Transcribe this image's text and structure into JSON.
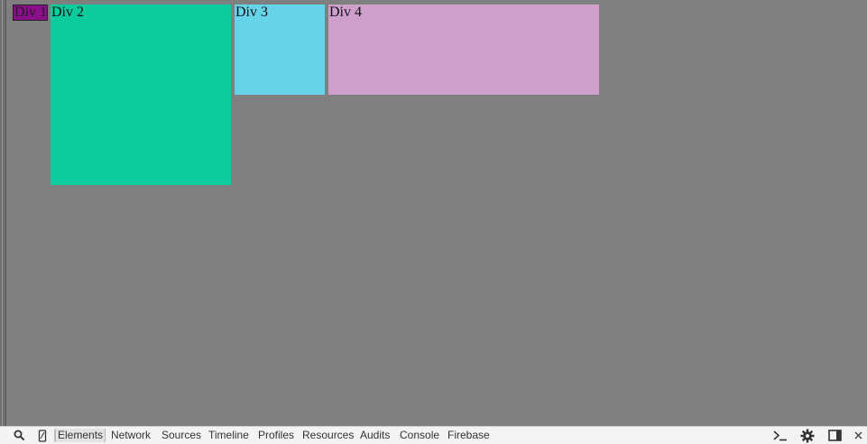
{
  "page": {
    "divs": [
      {
        "id": "div1",
        "label": "Div 1",
        "color": "#8b0f8b"
      },
      {
        "id": "div2",
        "label": "Div 2",
        "color": "#0acc9d"
      },
      {
        "id": "div3",
        "label": "Div 3",
        "color": "#66d4e8"
      },
      {
        "id": "div4",
        "label": "Div 4",
        "color": "#cf9fcc"
      }
    ]
  },
  "devtools": {
    "icons": {
      "search": "search-icon",
      "device": "device-mode-icon",
      "console_drawer": "console-drawer-icon",
      "settings": "gear-icon",
      "dock": "dock-side-icon",
      "close": "close-icon"
    },
    "tabs": [
      {
        "label": "Elements",
        "active": true
      },
      {
        "label": "Network"
      },
      {
        "label": "Sources"
      },
      {
        "label": "Timeline"
      },
      {
        "label": "Profiles"
      },
      {
        "label": "Resources"
      },
      {
        "label": "Audits"
      },
      {
        "label": "Console"
      },
      {
        "label": "Firebase"
      }
    ]
  }
}
